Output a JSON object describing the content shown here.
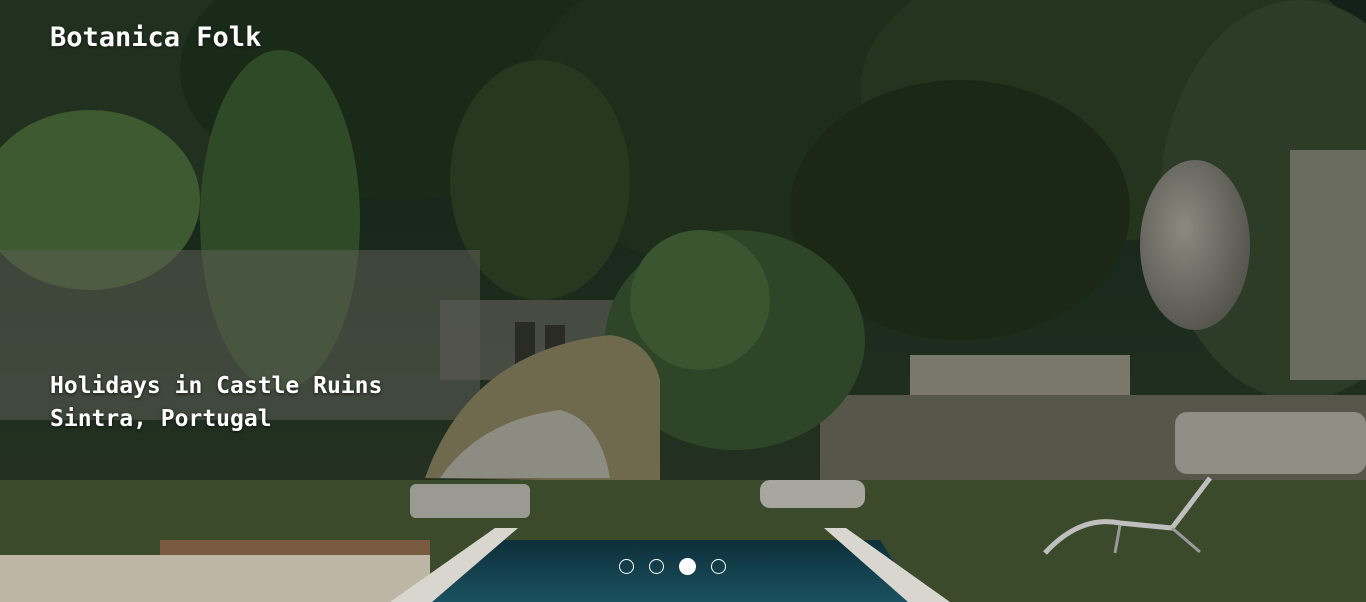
{
  "site": {
    "brand": "Botanica Folk"
  },
  "slide": {
    "caption_line1": "Holidays in Castle Ruins",
    "caption_line2": "Sintra, Portugal",
    "image_description_icon": "garden-photo"
  },
  "carousel": {
    "slide_count": 4,
    "active_index": 2
  },
  "colors": {
    "text": "#ffffff",
    "foliage_dark": "#1c2a1a",
    "pool_water": "#123a45"
  }
}
